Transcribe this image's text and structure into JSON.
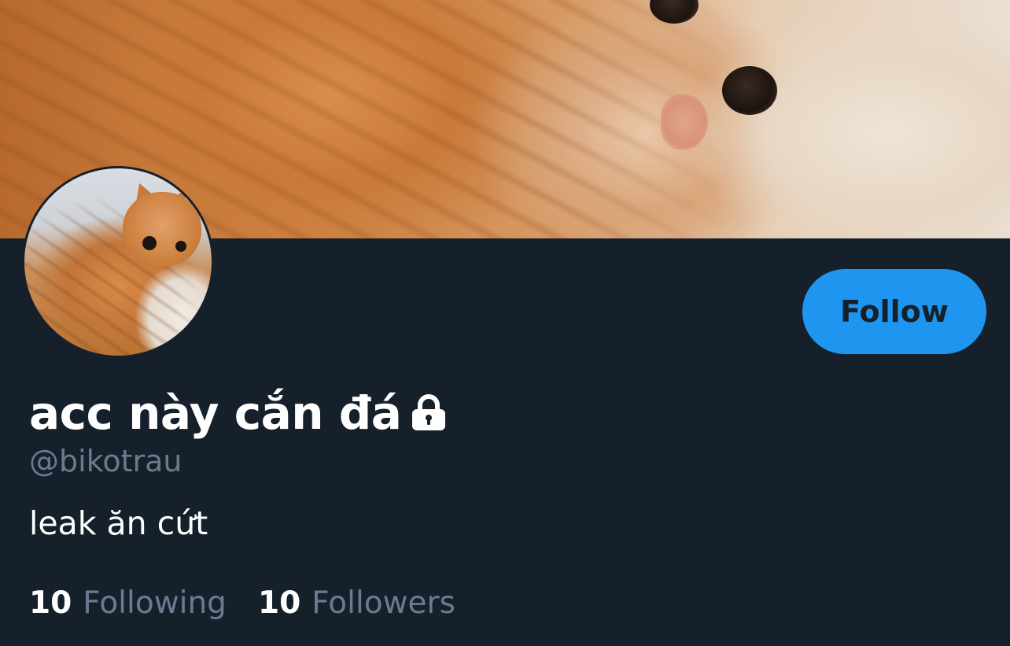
{
  "profile": {
    "display_name": "acc này cắn đá",
    "protected_icon": "lock-icon",
    "handle": "@bikotrau",
    "bio": "leak ăn cứt",
    "banner_image": "orange-cat-photo",
    "avatar_image": "orange-cat-avatar"
  },
  "actions": {
    "follow_label": "Follow"
  },
  "stats": {
    "following_count": "10",
    "following_label": "Following",
    "followers_count": "10",
    "followers_label": "Followers"
  },
  "colors": {
    "background": "#16202b",
    "accent": "#1e96f0",
    "primary_text": "#ffffff",
    "secondary_text": "#697c8f"
  }
}
